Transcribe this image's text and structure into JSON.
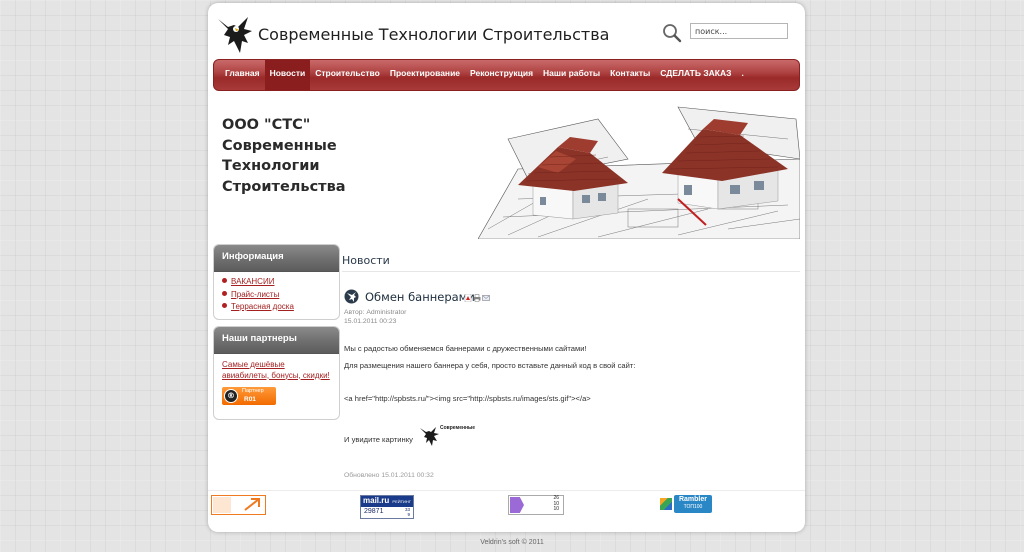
{
  "header": {
    "site_title": "Современные Технологии Строительства",
    "search_placeholder": "поиск..."
  },
  "nav": {
    "items": [
      {
        "label": "Главная",
        "active": false
      },
      {
        "label": "Новости",
        "active": true
      },
      {
        "label": "Строительство",
        "active": false
      },
      {
        "label": "Проектирование",
        "active": false
      },
      {
        "label": "Реконструкция",
        "active": false
      },
      {
        "label": "Наши работы",
        "active": false
      },
      {
        "label": "Контакты",
        "active": false
      },
      {
        "label": "СДЕЛАТЬ ЗАКАЗ",
        "active": false
      },
      {
        "label": ".",
        "active": false
      }
    ]
  },
  "banner": {
    "line1": "ООО \"СТС\"",
    "line2": "Современные",
    "line3": "Технологии",
    "line4": "Строительства"
  },
  "sidebar": {
    "info": {
      "title": "Информация",
      "links": [
        "ВАКАНСИИ",
        "Прайс-листы",
        "Террасная доска"
      ]
    },
    "partners": {
      "title": "Наши партнеры",
      "link": "Самые дешёвые авиабилеты, бонусы, скидки!",
      "badge_label": "Партнер",
      "badge_code": "R01"
    }
  },
  "content": {
    "section_title": "Новости",
    "article": {
      "title": "Обмен баннерами",
      "author": "Автор: Administrator",
      "date": "15.01.2011 00:23",
      "p1": "Мы с радостью обменяемся баннерами с дружественными сайтами!",
      "p2": "Для размещения нашего баннера у себя, просто вставьте данный код в свой сайт:",
      "code": "<a href=\"http://spbsts.ru/\"><img src=\"http://spbsts.ru/images/sts.gif\"></a>",
      "p3": "И увидите картинку",
      "mini_logo_text": "Современные",
      "updated": "Обновлено 15.01.2011 00:32"
    }
  },
  "footer": {
    "mailru": {
      "name": "mail.ru",
      "rating": "РЕЙТИНГ",
      "count": "29871",
      "small_top": "33",
      "small_bottom": "9"
    },
    "counter3": {
      "line1": "26",
      "line2": "10",
      "line3": "10"
    },
    "rambler": {
      "name": "Rambler",
      "sub": "ТОП100"
    },
    "copyright": "Veldrin's soft © 2011"
  },
  "colors": {
    "nav_red": "#a83a3a",
    "link_red": "#a42020",
    "sidebar_head": "#6f6f6f"
  }
}
